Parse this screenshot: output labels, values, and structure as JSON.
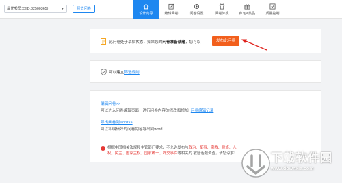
{
  "topbar": {
    "survey_name": "最优秀员工(ID:82500365)",
    "preview_label": "预览问卷"
  },
  "nav": [
    {
      "label": "设计向导",
      "icon": "home-icon",
      "active": true
    },
    {
      "label": "编辑问卷",
      "icon": "edit-icon",
      "active": false
    },
    {
      "label": "问卷设置",
      "icon": "settings-icon",
      "active": false
    },
    {
      "label": "问卷外观",
      "icon": "appearance-icon",
      "active": false
    },
    {
      "label": "红包&奖品",
      "icon": "gift-icon",
      "active": false
    },
    {
      "label": "质量控制",
      "icon": "quality-icon",
      "active": false
    }
  ],
  "notice": {
    "text_before": "此问卷处于草稿状态，如果您的",
    "text_bold": "问卷准备就绪",
    "text_after": "，您可以",
    "publish_label": "发布此问卷"
  },
  "screening": {
    "prefix": "可以建立",
    "link": "筛选规则"
  },
  "edit": {
    "link": "编辑问卷>>",
    "desc": "可以进入问卷编辑页面，进行问卷内容的修改和增加",
    "history_link": "问卷编辑记录"
  },
  "export": {
    "link": "导出问卷到word>>",
    "desc": "可以将编辑好的问卷内容导出到word"
  },
  "warning": {
    "p1": "根据中国相关法规和主管部门要求，不允许发布与",
    "r1": "政治、军事、宗教、民族、人权、民主、国家主权、国家统一、外交事件",
    "p2": "等相关的 敏感话题调查，请您谅解！"
  },
  "watermark": {
    "text": "下载软件园",
    "url": "www.downxia.com"
  },
  "colors": {
    "primary": "#1e87f0",
    "publish": "#f25f1c",
    "arrow": "#e0201a"
  }
}
